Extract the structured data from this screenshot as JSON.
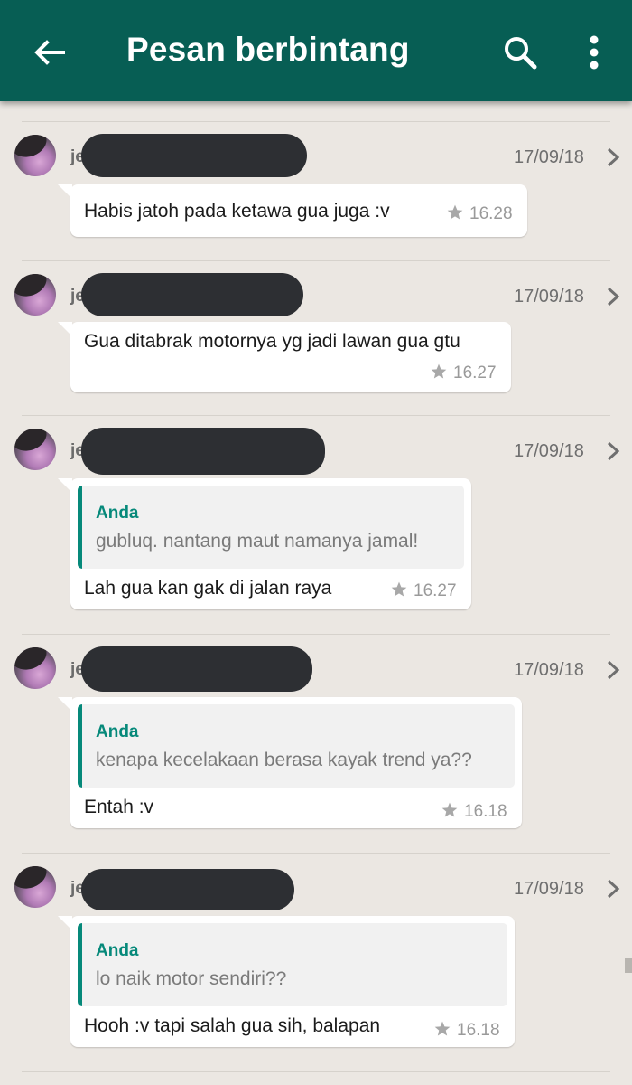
{
  "appbar": {
    "title": "Pesan berbintang",
    "back_icon": "arrow-left-icon",
    "search_icon": "search-icon",
    "more_icon": "more-vert-icon",
    "color": "#075e54"
  },
  "messages": [
    {
      "sender_visible": "je",
      "date": "17/09/18",
      "text": "Habis jatoh pada ketawa gua juga :v",
      "time": "16.28",
      "quote": null
    },
    {
      "sender_visible": "je",
      "date": "17/09/18",
      "text": "Gua ditabrak motornya yg jadi lawan gua gtu",
      "time": "16.27",
      "quote": null
    },
    {
      "sender_visible": "je",
      "date": "17/09/18",
      "text": "Lah gua kan gak di jalan raya",
      "time": "16.27",
      "quote": {
        "name": "Anda",
        "text": "gubluq. nantang maut namanya jamal!"
      }
    },
    {
      "sender_visible": "je",
      "date": "17/09/18",
      "text": "Entah :v",
      "time": "16.18",
      "quote": {
        "name": "Anda",
        "text": "kenapa kecelakaan berasa kayak trend ya??"
      }
    },
    {
      "sender_visible": "je",
      "date": "17/09/18",
      "text": "Hooh :v tapi salah gua sih, balapan",
      "time": "16.18",
      "quote": {
        "name": "Anda",
        "text": "lo naik motor sendiri??"
      }
    }
  ],
  "colors": {
    "background": "#ebe7e2",
    "quote_accent": "#06897a",
    "redaction": "#2d2f33"
  }
}
